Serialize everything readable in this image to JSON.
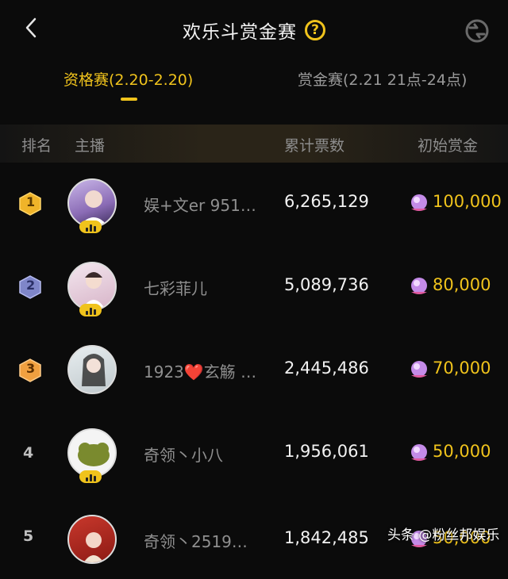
{
  "header": {
    "title": "欢乐斗赏金赛",
    "help_icon": "?"
  },
  "tabs": [
    {
      "label": "资格赛(2.20-2.20)",
      "active": true
    },
    {
      "label": "赏金赛(2.21 21点-24点)",
      "active": false
    }
  ],
  "columns": {
    "rank": "排名",
    "anchor": "主播",
    "votes": "累计票数",
    "prize": "初始赏金"
  },
  "rows": [
    {
      "rank": "1",
      "name": "娱+文er 951…",
      "votes": "6,265,129",
      "prize": "100,000",
      "live": true
    },
    {
      "rank": "2",
      "name": "七彩菲儿",
      "votes": "5,089,736",
      "prize": "80,000",
      "live": true
    },
    {
      "rank": "3",
      "name": "1923❤️玄觞 …",
      "votes": "2,445,486",
      "prize": "70,000",
      "live": false
    },
    {
      "rank": "4",
      "name": "奇领丶小八",
      "votes": "1,956,061",
      "prize": "50,000",
      "live": true
    },
    {
      "rank": "5",
      "name": "奇领丶2519…",
      "votes": "1,842,485",
      "prize": "50,000",
      "live": false
    }
  ],
  "watermark": "头条 @粉丝邦娱乐",
  "colors": {
    "accent": "#f0c31c",
    "background": "#0b0b0b",
    "rank1": "#f0b429",
    "rank2": "#7f86c9",
    "rank3": "#f0a040"
  }
}
